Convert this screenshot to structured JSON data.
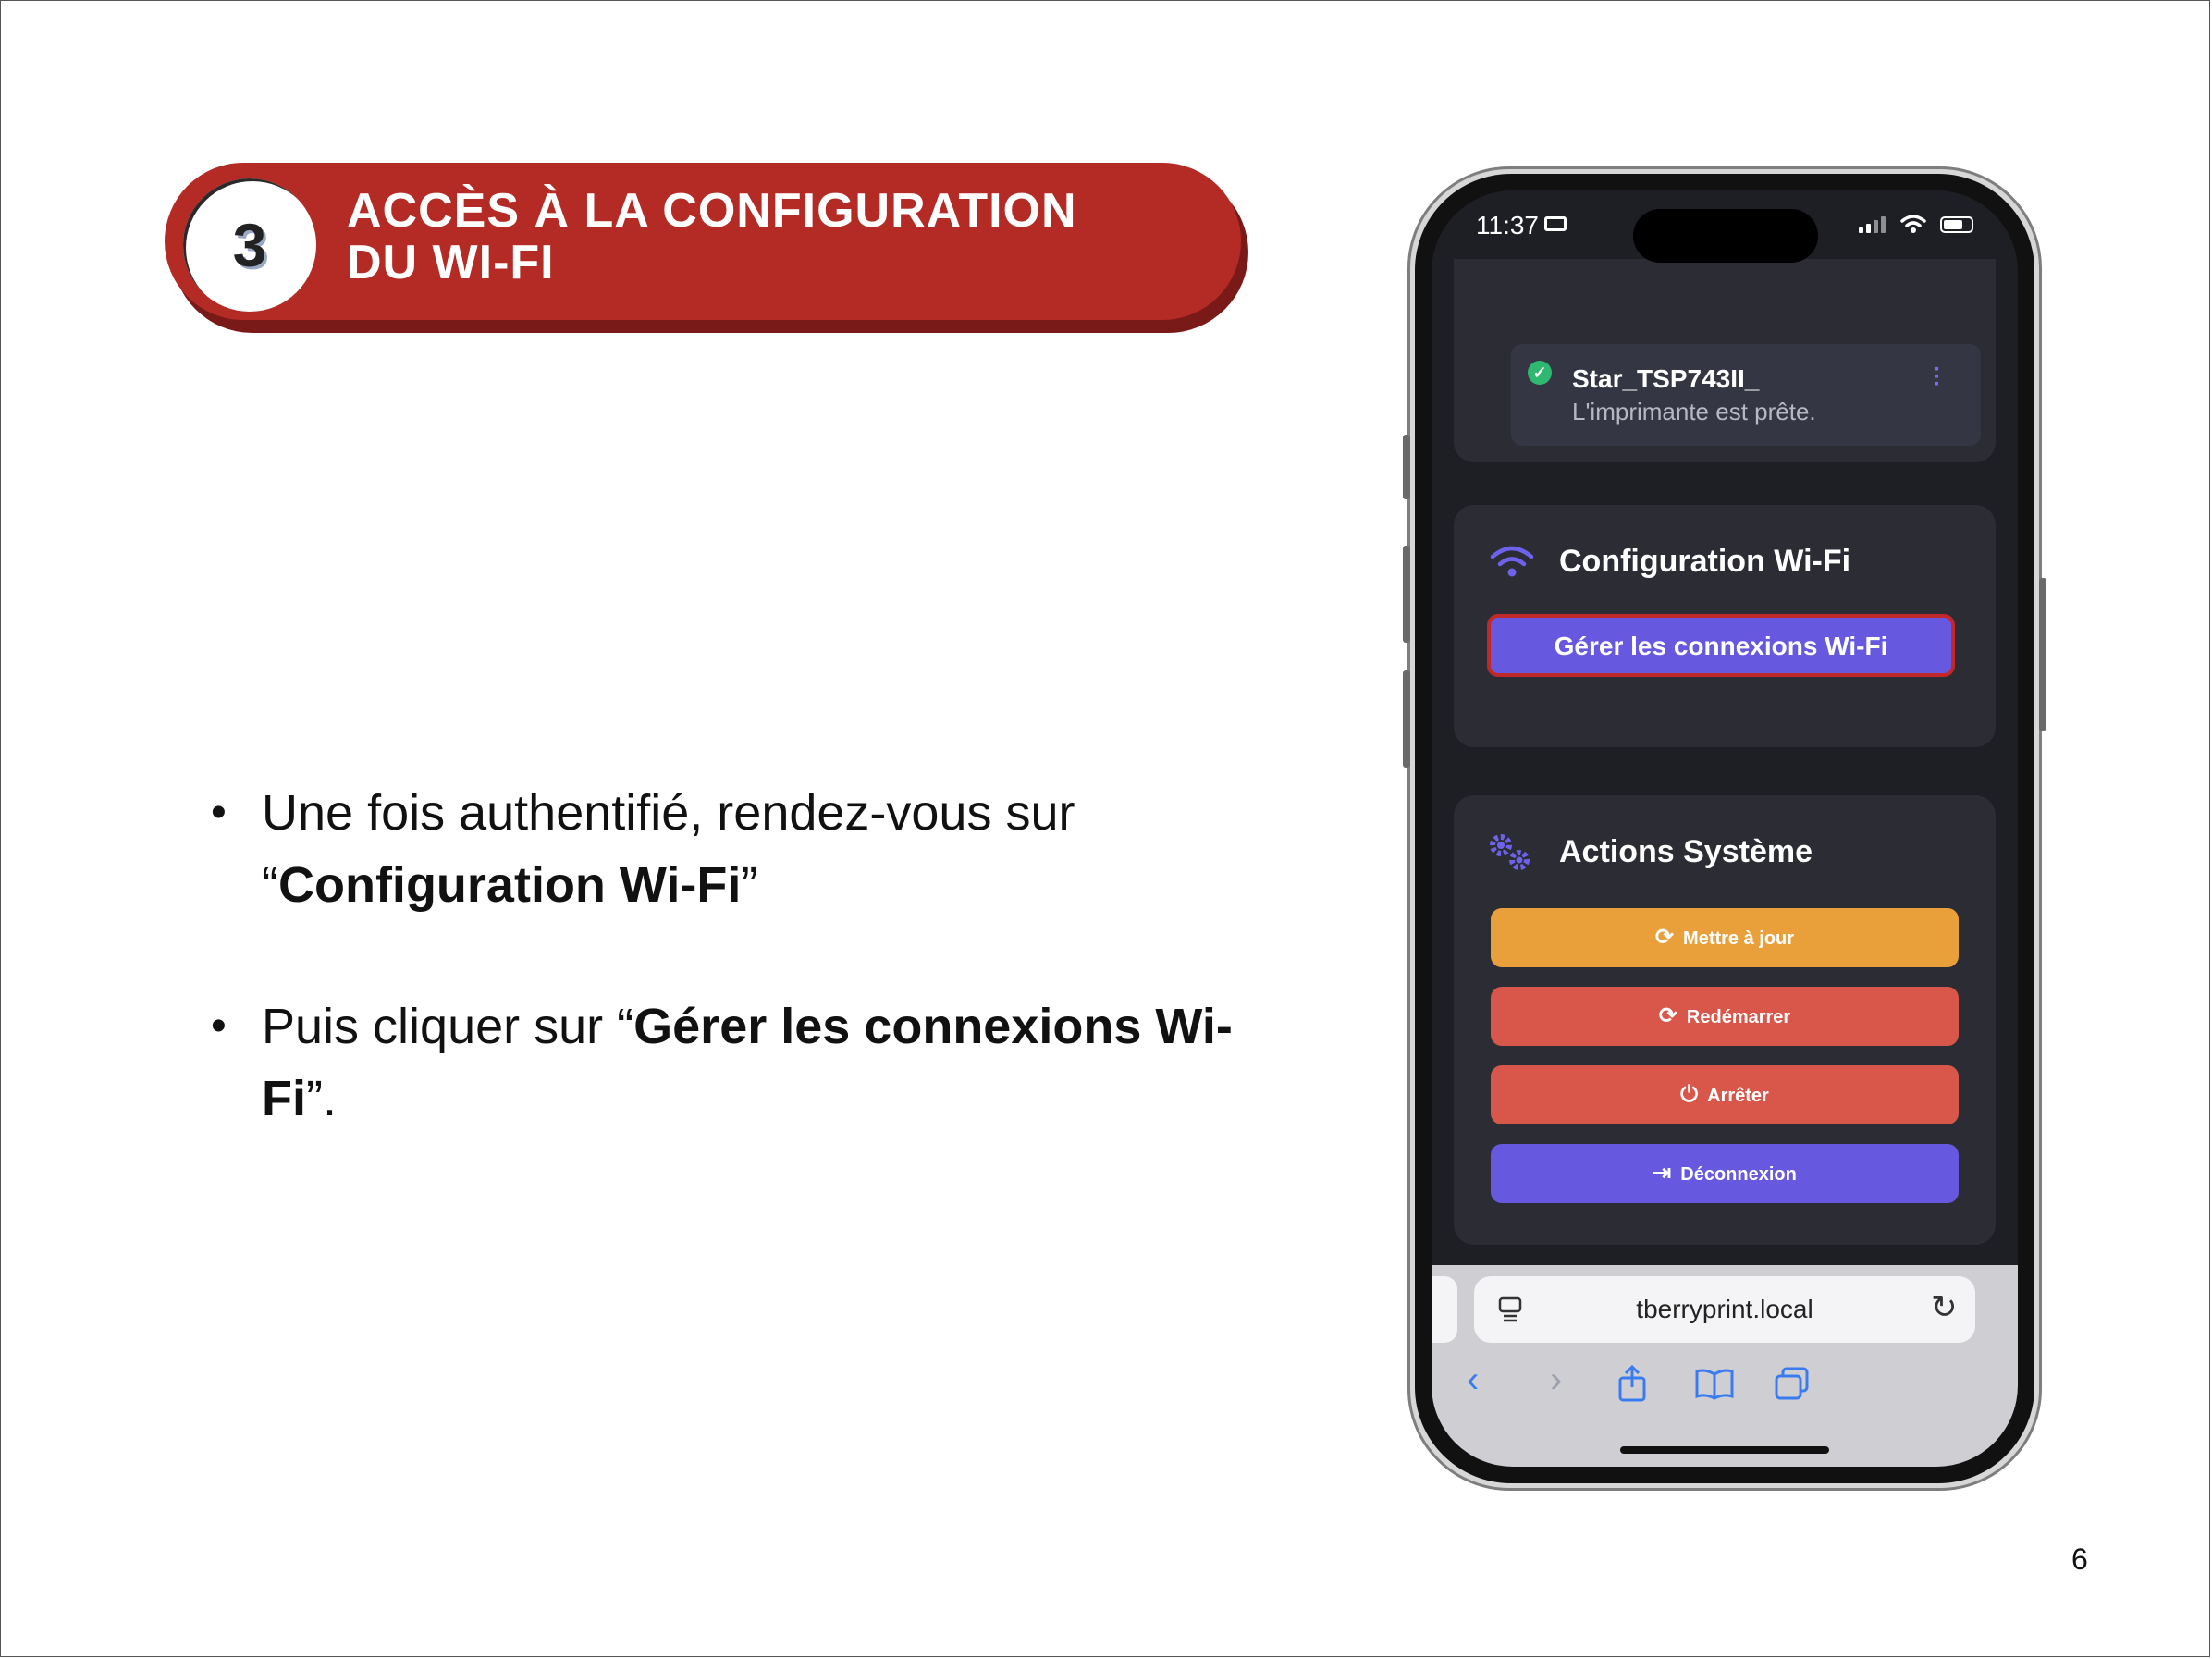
{
  "header": {
    "step_number": "3",
    "title_line1": "ACCÈS À LA CONFIGURATION",
    "title_line2": "DU WI-FI"
  },
  "bullets": [
    {
      "prefix": "Une fois authentifié, rendez-vous sur “",
      "bold": "Configuration Wi-Fi",
      "suffix": "”"
    },
    {
      "prefix": "Puis cliquer sur “",
      "bold": "Gérer les connexions Wi-Fi",
      "suffix": "”."
    }
  ],
  "page_number": "6",
  "phone": {
    "status": {
      "time": "11:37"
    },
    "printer": {
      "name": "Star_TSP743II_",
      "status": "L'imprimante est prête."
    },
    "wifi_section": {
      "title": "Configuration Wi-Fi",
      "button": "Gérer les connexions Wi-Fi",
      "icon": "wifi-icon"
    },
    "system_section": {
      "title": "Actions Système",
      "icon": "gears-icon",
      "buttons": [
        {
          "label": "Mettre à jour",
          "icon": "sync-icon",
          "color": "#e9a03b"
        },
        {
          "label": "Redémarrer",
          "icon": "sync-icon",
          "color": "#d9574a"
        },
        {
          "label": "Arrêter",
          "icon": "power-icon",
          "color": "#d9574a"
        },
        {
          "label": "Déconnexion",
          "icon": "logout-icon",
          "color": "#6758e0"
        }
      ]
    },
    "browser": {
      "url": "tberryprint.local"
    }
  },
  "colors": {
    "banner": "#b42a25",
    "accent_purple": "#6758e0",
    "highlight_border": "#c0282a"
  }
}
